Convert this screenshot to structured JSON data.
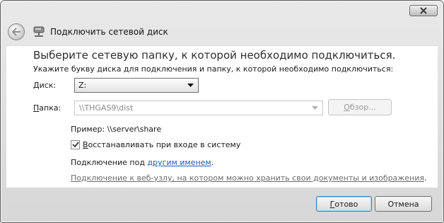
{
  "window": {
    "title": "Подключить сетевой диск"
  },
  "icons": {
    "close": "close-x-icon",
    "back": "back-arrow-icon",
    "network": "network-drive-icon",
    "dropdown": "dropdown-arrow-icon",
    "check": "checkmark-icon"
  },
  "main": {
    "heading": "Выберите сетевую папку, к которой необходимо подключиться.",
    "instruction": "Укажите букву диска для подключения и папку, к которой необходимо подключиться:"
  },
  "drive": {
    "label_pre": "",
    "label_ul": "Д",
    "label_post": "иск:",
    "value": "Z:"
  },
  "folder": {
    "label_ul": "П",
    "label_post": "апка:",
    "value": "\\\\THGAS9\\dist"
  },
  "browse": {
    "label_ul": "О",
    "label_post": "бзор..."
  },
  "example": {
    "text": "Пример: \\\\server\\share"
  },
  "reconnect": {
    "checked": true,
    "label_ul": "В",
    "label_post": "осстанавливать при входе в систему"
  },
  "other_user": {
    "prefix": "Подключение под ",
    "link": "другим именем",
    "suffix": "."
  },
  "web_link": {
    "text": "Подключение к веб-узлу, на котором можно хранить свои документы и изображения",
    "suffix": "."
  },
  "footer": {
    "ok_ul": "Г",
    "ok_post": "отово",
    "cancel": "Отмена"
  }
}
